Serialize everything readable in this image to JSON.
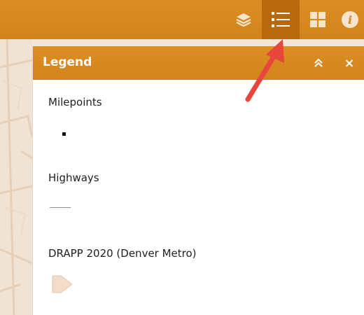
{
  "toolbar": {
    "buttons": [
      {
        "icon": "layers-icon",
        "active": false
      },
      {
        "icon": "legend-list-icon",
        "active": true
      },
      {
        "icon": "basemap-grid-icon",
        "active": false
      },
      {
        "icon": "info-icon",
        "active": false,
        "label": "i"
      }
    ],
    "colors": {
      "bar": "#d98a1f",
      "active": "#b8680d"
    }
  },
  "legend_panel": {
    "title": "Legend",
    "collapse_icon": "double-chevron-up-icon",
    "close_label": "×",
    "sections": [
      {
        "label": "Milepoints",
        "symbol": "point-symbol"
      },
      {
        "label": "Highways",
        "symbol": "line-symbol"
      },
      {
        "label": "DRAPP 2020 (Denver Metro)",
        "symbol": "polygon-symbol"
      }
    ]
  },
  "annotation": {
    "icon": "red-arrow-icon",
    "color": "#e8463c"
  }
}
